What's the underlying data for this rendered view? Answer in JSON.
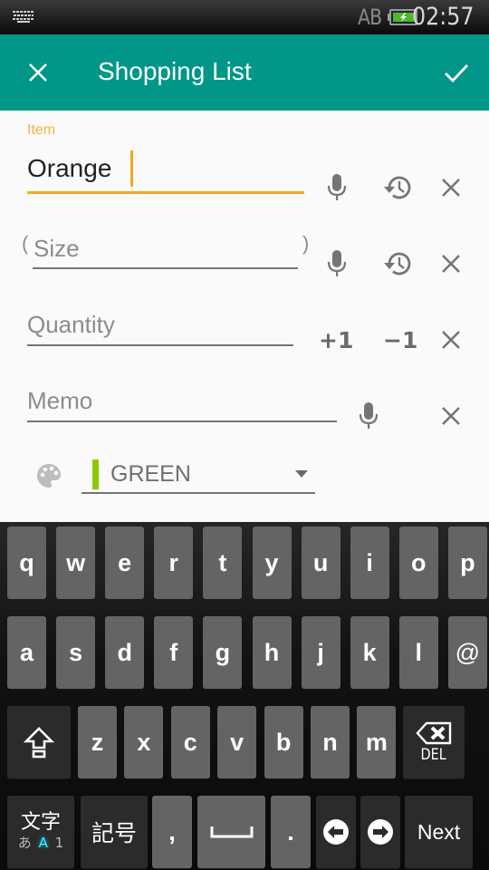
{
  "status_bar": {
    "keyboard_icon": "keyboard-icon",
    "input_mode": "AB",
    "battery_icon": "battery-charging-icon",
    "time": "02:57"
  },
  "toolbar": {
    "close_icon": "close-icon",
    "title": "Shopping List",
    "done_icon": "check-icon",
    "accent_color": "#009688"
  },
  "form": {
    "item": {
      "label": "Item",
      "value": "Orange",
      "focus_color": "#f5a623"
    },
    "size": {
      "placeholder": "Size",
      "open_paren": "(",
      "close_paren": ")"
    },
    "quantity": {
      "placeholder": "Quantity",
      "increment_label": "+1",
      "decrement_label": "−1"
    },
    "memo": {
      "placeholder": "Memo"
    },
    "color": {
      "selected": "GREEN",
      "swatch_color": "#8cc800"
    }
  },
  "keyboard": {
    "row1": [
      "q",
      "w",
      "e",
      "r",
      "t",
      "y",
      "u",
      "i",
      "o",
      "p"
    ],
    "row2": [
      "a",
      "s",
      "d",
      "f",
      "g",
      "h",
      "j",
      "k",
      "l",
      "@"
    ],
    "row3": [
      "z",
      "x",
      "c",
      "v",
      "b",
      "n",
      "m"
    ],
    "del_label": "DEL",
    "mode_key": {
      "top": "文字",
      "hira": "あ",
      "alpha": "A",
      "num": "1"
    },
    "symbol_key": "記号",
    "comma": ",",
    "period": ".",
    "next_label": "Next"
  }
}
